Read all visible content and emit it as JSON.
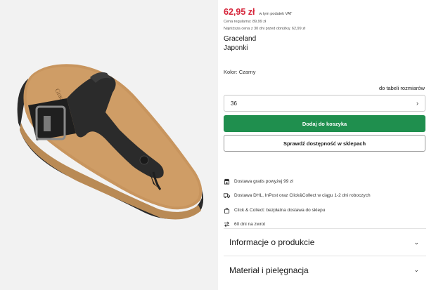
{
  "product": {
    "price": "62,95 zł",
    "vat_note": "w tym podatek VAT",
    "regular_price": "Cena regularna: 89,99 zł",
    "lowest_price": "Najniższa cena z 30 dni przed obniżką: 62,99 zł",
    "brand": "Graceland",
    "type": "Japonki",
    "color_label": "Kolor:",
    "color_value": "Czarny",
    "image_brand_text": "Graceland"
  },
  "size": {
    "table_link": "do tabeli rozmiarów",
    "selected": "36"
  },
  "actions": {
    "add_to_cart": "Dodaj do koszyka",
    "check_availability": "Sprawdź dostępność w sklepach"
  },
  "benefits": [
    {
      "icon": "store-icon",
      "text": "Dostawa gratis powyżej 99 zł"
    },
    {
      "icon": "truck-icon",
      "text": "Dostawa DHL, InPost oraz Click&Collect w ciągu 1-2 dni roboczych"
    },
    {
      "icon": "shopping-bag-icon",
      "text": "Click & Collect: bezpłatna dostawa do sklepu"
    },
    {
      "icon": "return-arrows-icon",
      "text": "60 dni na zwrot"
    }
  ],
  "accordion": [
    {
      "title": "Informacje o produkcie"
    },
    {
      "title": "Materiał i pielęgnacja"
    }
  ],
  "colors": {
    "price": "#d6263b",
    "add_button": "#1f8f4e"
  }
}
